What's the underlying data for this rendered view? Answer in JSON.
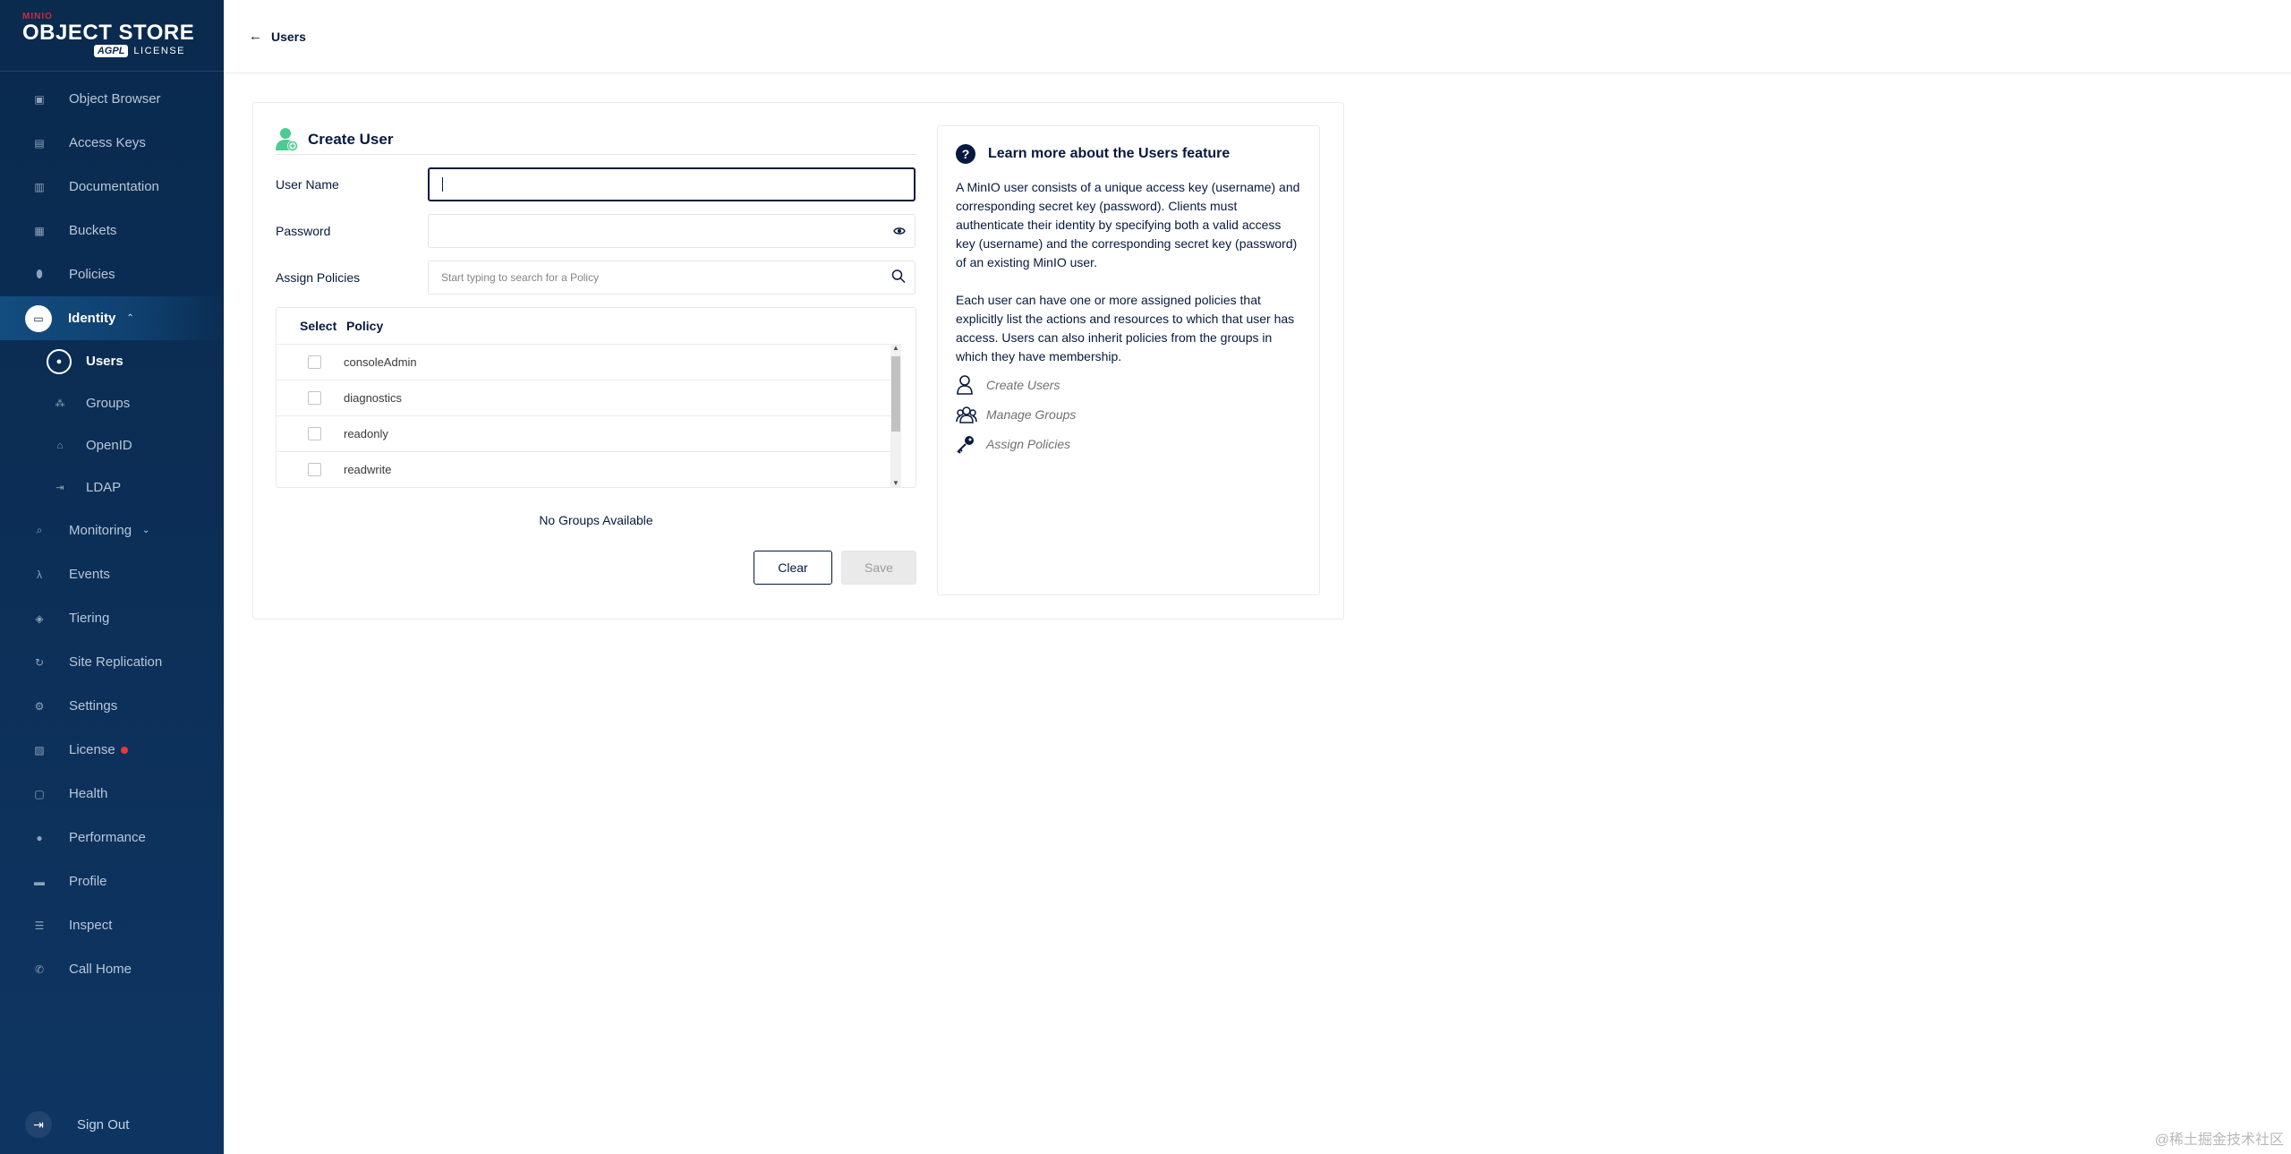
{
  "logo": {
    "brand": "MINIO",
    "product": "OBJECT STORE",
    "edition": "AGPL",
    "license_text": "LICENSE"
  },
  "sidebar": {
    "items": [
      {
        "label": "Object Browser",
        "icon": "object-browser-icon"
      },
      {
        "label": "Access Keys",
        "icon": "access-keys-icon"
      },
      {
        "label": "Documentation",
        "icon": "documentation-icon"
      },
      {
        "label": "Buckets",
        "icon": "buckets-icon"
      },
      {
        "label": "Policies",
        "icon": "policies-icon"
      },
      {
        "label": "Identity",
        "icon": "identity-icon",
        "expanded": true
      },
      {
        "label": "Monitoring",
        "icon": "monitoring-icon"
      },
      {
        "label": "Events",
        "icon": "lambda-icon"
      },
      {
        "label": "Tiering",
        "icon": "tiering-icon"
      },
      {
        "label": "Site Replication",
        "icon": "site-replication-icon"
      },
      {
        "label": "Settings",
        "icon": "settings-icon"
      },
      {
        "label": "License",
        "icon": "license-icon",
        "badge_color": "#e53935"
      },
      {
        "label": "Health",
        "icon": "health-icon"
      },
      {
        "label": "Performance",
        "icon": "performance-icon"
      },
      {
        "label": "Profile",
        "icon": "profile-icon"
      },
      {
        "label": "Inspect",
        "icon": "inspect-icon"
      },
      {
        "label": "Call Home",
        "icon": "call-home-icon"
      }
    ],
    "identity_sub": [
      {
        "label": "Users",
        "icon": "user-icon",
        "active": true
      },
      {
        "label": "Groups",
        "icon": "groups-icon"
      },
      {
        "label": "OpenID",
        "icon": "lock-icon"
      },
      {
        "label": "LDAP",
        "icon": "login-icon"
      }
    ],
    "sign_out": "Sign Out"
  },
  "topbar": {
    "back_label": "Users"
  },
  "form": {
    "title": "Create User",
    "username_label": "User Name",
    "username_value": "",
    "password_label": "Password",
    "password_value": "",
    "policies_label": "Assign Policies",
    "policies_placeholder": "Start typing to search for a Policy",
    "table": {
      "headers": [
        "Select",
        "Policy"
      ],
      "rows": [
        {
          "policy": "consoleAdmin",
          "checked": false
        },
        {
          "policy": "diagnostics",
          "checked": false
        },
        {
          "policy": "readonly",
          "checked": false
        },
        {
          "policy": "readwrite",
          "checked": false
        }
      ]
    },
    "no_groups": "No Groups Available",
    "clear_label": "Clear",
    "save_label": "Save"
  },
  "help": {
    "title": "Learn more about the Users feature",
    "p1": "A MinIO user consists of a unique access key (username) and corresponding secret key (password). Clients must authenticate their identity by specifying both a valid access key (username) and the corresponding secret key (password) of an existing MinIO user.",
    "p2": "Each user can have one or more assigned policies that explicitly list the actions and resources to which that user has access. Users can also inherit policies from the groups in which they have membership.",
    "links": [
      "Create Users",
      "Manage Groups",
      "Assign Policies"
    ]
  },
  "colors": {
    "sidebar_bg": "#0a2a4e",
    "accent": "#07193e",
    "brand": "#c72c48",
    "user_icon": "#4ccb92"
  },
  "watermark": "@稀土掘金技术社区"
}
